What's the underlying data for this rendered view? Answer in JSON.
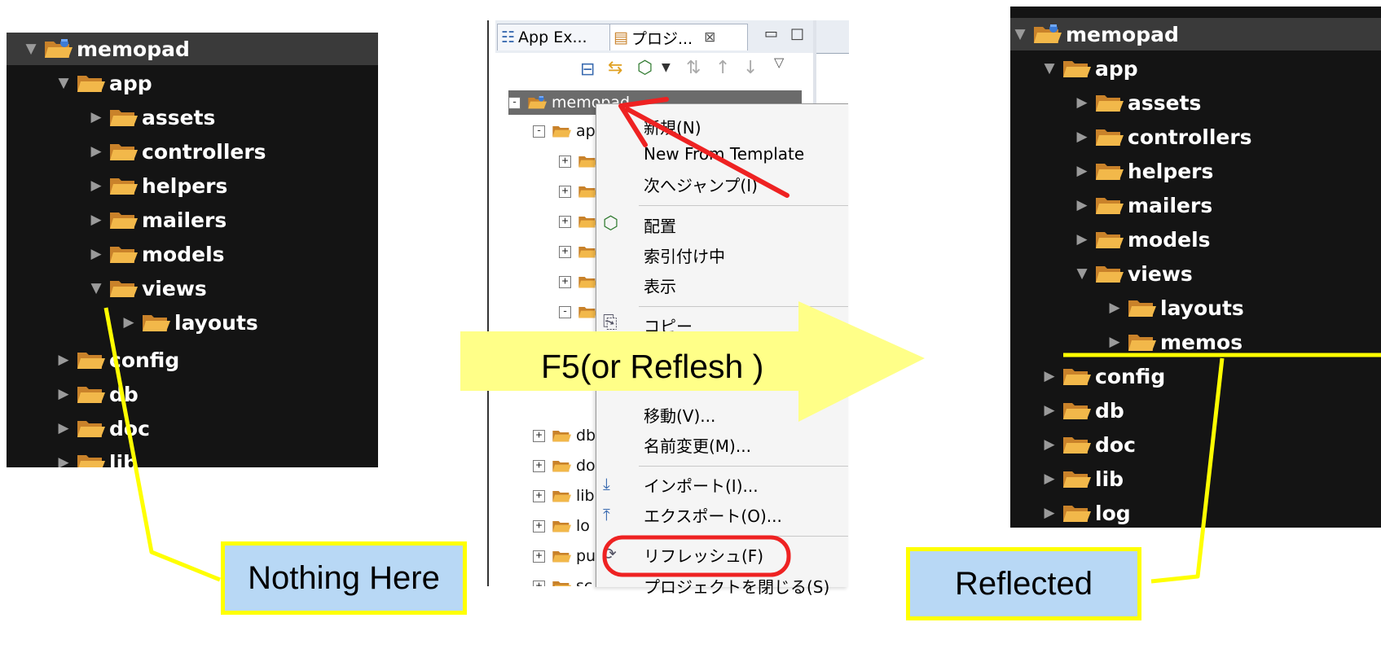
{
  "left_tree": {
    "root": "memopad",
    "items": [
      "app",
      "assets",
      "controllers",
      "helpers",
      "mailers",
      "models",
      "views",
      "layouts",
      "config",
      "db",
      "doc",
      "lib"
    ]
  },
  "eclipse": {
    "tabs": [
      "App Ex...",
      "プロジ..."
    ],
    "tab_close": "⊠",
    "root": "memopad",
    "rows": [
      "ap",
      "db",
      "do",
      "lib",
      "lo",
      "pu",
      "sc"
    ]
  },
  "context_menu": {
    "items": [
      "新規(N)",
      "New From Template",
      "次へジャンプ(I)",
      "配置",
      "索引付け中",
      "表示",
      "コピー",
      "移動(V)...",
      "名前変更(M)...",
      "インポート(I)...",
      "エクスポート(O)...",
      "リフレッシュ(F)",
      "プロジェクトを閉じる(S)"
    ]
  },
  "arrow_label": "F5(or Reflesh )",
  "right_tree": {
    "root": "memopad",
    "items": [
      "app",
      "assets",
      "controllers",
      "helpers",
      "mailers",
      "models",
      "views",
      "layouts",
      "memos",
      "config",
      "db",
      "doc",
      "lib",
      "log"
    ]
  },
  "callouts": {
    "left": "Nothing Here",
    "right": "Reflected"
  },
  "colors": {
    "highlight_yellow": "#ffff00",
    "arrow_yellow": "#ffff88",
    "red": "#ee2222",
    "callout_blue": "#b8d8f5",
    "folder_orange": "#f0a830"
  }
}
